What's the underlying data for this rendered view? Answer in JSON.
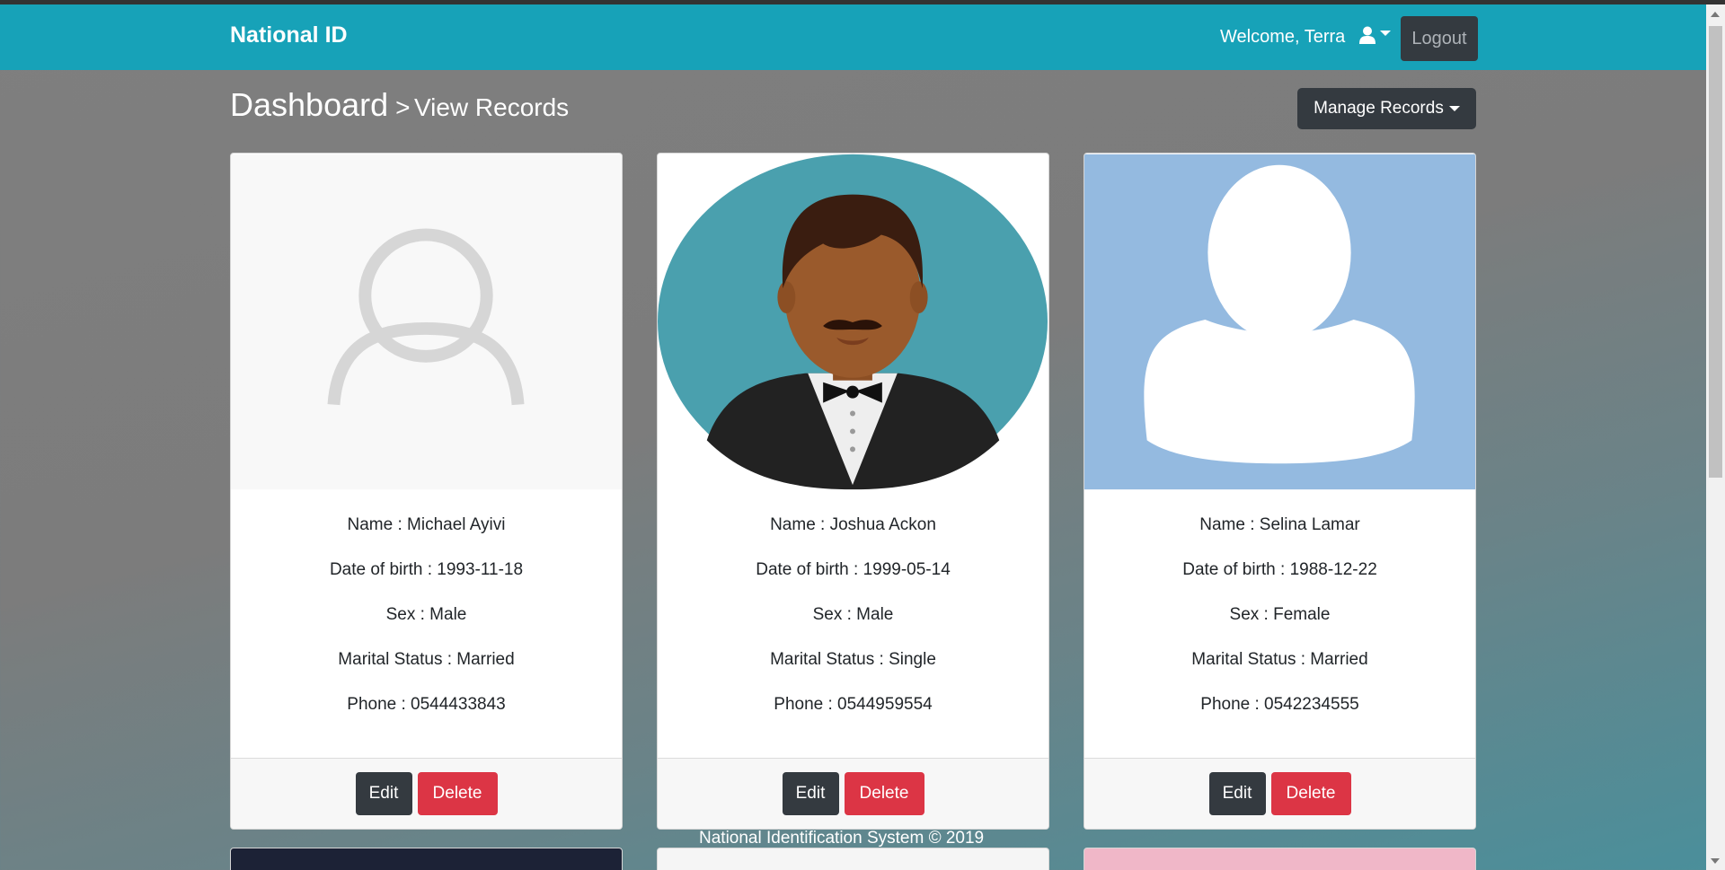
{
  "nav": {
    "brand": "National ID",
    "welcome": "Welcome, Terra",
    "user_icon": "user-icon",
    "logout_label": "Logout"
  },
  "header": {
    "title": "Dashboard",
    "separator": ">",
    "subtitle": "View Records",
    "manage_label": "Manage Records"
  },
  "records": [
    {
      "name": "Name : Michael Ayivi",
      "dob": "Date of birth : 1993-11-18",
      "sex": "Sex : Male",
      "marital": "Marital Status : Married",
      "phone": "Phone : 0544433843",
      "avatar": "default-avatar-outline"
    },
    {
      "name": "Name : Joshua Ackon",
      "dob": "Date of birth : 1999-05-14",
      "sex": "Sex : Male",
      "marital": "Marital Status : Single",
      "phone": "Phone : 0544959554",
      "avatar": "man-tuxedo-avatar"
    },
    {
      "name": "Name : Selina Lamar",
      "dob": "Date of birth : 1988-12-22",
      "sex": "Sex : Female",
      "marital": "Marital Status : Married",
      "phone": "Phone : 0542234555",
      "avatar": "silhouette-avatar"
    }
  ],
  "buttons": {
    "edit": "Edit",
    "delete": "Delete"
  },
  "footer": {
    "text": "National Identification System © 2019"
  },
  "colors": {
    "navbar": "#17a2b8",
    "dark_button": "#343a40",
    "danger_button": "#dc3545"
  }
}
